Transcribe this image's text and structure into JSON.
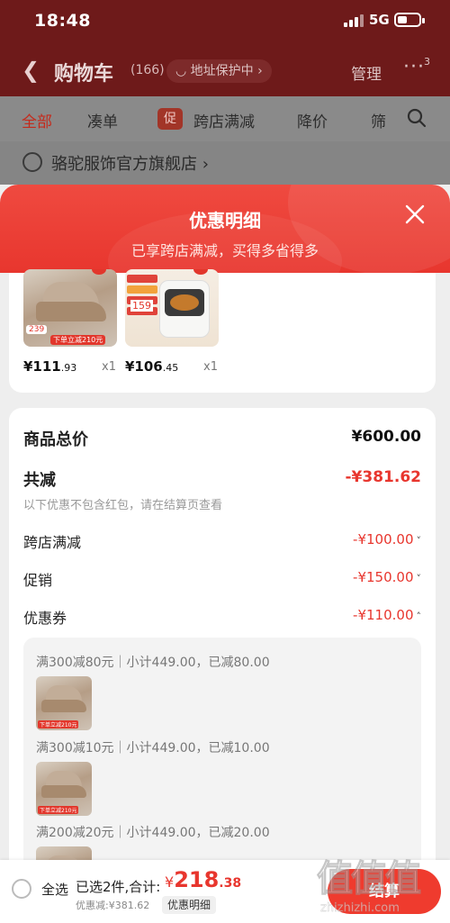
{
  "status_bar": {
    "time": "18:48",
    "network": "5G"
  },
  "nav": {
    "title": "购物车",
    "count": "(166)",
    "address_protect": "地址保护中",
    "manage": "管理",
    "more_badge": "3"
  },
  "tabs": {
    "items": [
      "全部",
      "凑单",
      "跨店满减",
      "降价",
      "筛"
    ],
    "active": "全部",
    "promo_badge": "促"
  },
  "shop": {
    "name": "骆驼服饰官方旗舰店"
  },
  "sheet": {
    "title": "优惠明细",
    "subtitle": "已享跨店满减，买得多省得多",
    "products": [
      {
        "price_main": "¥111",
        "price_cents": ".93",
        "qty": "x1",
        "tag": "239",
        "tagline": "下单立减210元"
      },
      {
        "price_main": "¥106",
        "price_cents": ".45",
        "qty": "x1",
        "tag": "159",
        "tagline": ""
      }
    ],
    "summary": {
      "goods_total_label": "商品总价",
      "goods_total": "¥600.00",
      "reduce_label": "共减",
      "reduce_total": "-¥381.62",
      "note": "以下优惠不包含红包，请在结算页查看",
      "rows": [
        {
          "label": "跨店满减",
          "value": "-¥100.00",
          "chevron": "˅"
        },
        {
          "label": "促销",
          "value": "-¥150.00",
          "chevron": "˅"
        },
        {
          "label": "优惠券",
          "value": "-¥110.00",
          "chevron": "˄"
        }
      ],
      "coupons": [
        {
          "text": "满300减80元｜小计449.00，已减80.00"
        },
        {
          "text": "满300减10元｜小计449.00，已减10.00"
        },
        {
          "text": "满200减20元｜小计449.00，已减20.00"
        }
      ],
      "coupon_thumb_tag": "下单立减210元"
    }
  },
  "bottom_bar": {
    "select_all": "全选",
    "selected": "已选2件,合计:",
    "currency": "¥",
    "total_main": "218",
    "total_cents": ".38",
    "discount": "优惠减:¥381.62",
    "detail_button": "优惠明细",
    "checkout": "结算",
    "watermark_glyphs": "值值值",
    "watermark_site": "zhizhizhi.com"
  },
  "colors": {
    "accent": "#e8362e",
    "header_dim": "#6e1a1a"
  }
}
